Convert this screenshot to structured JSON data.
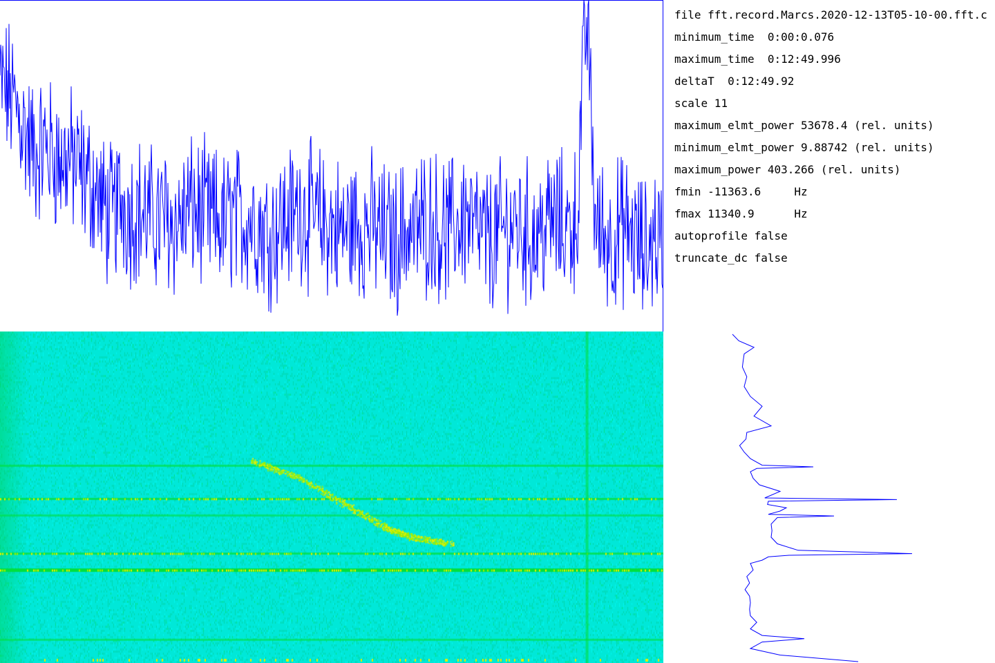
{
  "info": {
    "lines": [
      {
        "key": "file",
        "value": "fft.record.Marcs.2020-12-13T05-10-00.fft.c"
      },
      {
        "key": "minimum_time",
        "value": " 0:00:0.076"
      },
      {
        "key": "maximum_time",
        "value": " 0:12:49.996"
      },
      {
        "key": "deltaT",
        "value": " 0:12:49.92"
      },
      {
        "key": "scale",
        "value": "11"
      },
      {
        "key": "maximum_elmt_power",
        "value": "53678.4 (rel. units)"
      },
      {
        "key": "minimum_elmt_power",
        "value": "9.88742 (rel. units)"
      },
      {
        "key": "maximum_power",
        "value": "403.266 (rel. units)"
      },
      {
        "key": "fmin",
        "value": "-11363.6     Hz"
      },
      {
        "key": "fmax",
        "value": "11340.9      Hz"
      },
      {
        "key": "autoprofile",
        "value": "false"
      },
      {
        "key": "truncate_dc",
        "value": "false"
      }
    ]
  },
  "colors": {
    "trace": "#0000ff",
    "frame": "#0000ff",
    "waterfall_background": "#00e8d8",
    "waterfall_band": "#00e040",
    "waterfall_strong": "#a0f000",
    "waterfall_peak": "#e8f000"
  },
  "chart_data": [
    {
      "type": "line",
      "name": "time-power-trace",
      "xlim": [
        0.076,
        769.996
      ],
      "ylim": [
        0,
        403.266
      ],
      "grid": false,
      "series": [
        {
          "x": [
            0,
            10,
            20,
            30,
            40,
            50,
            60,
            70,
            80,
            90,
            100,
            110,
            120,
            130,
            140,
            150,
            160,
            170,
            180,
            190,
            200,
            210,
            220,
            230,
            240,
            250,
            260,
            270,
            280,
            290,
            300,
            310,
            320,
            330,
            340,
            350,
            360,
            370,
            380,
            390,
            400,
            410,
            420,
            430,
            440,
            450,
            460,
            470,
            480,
            490,
            500,
            510,
            520,
            530,
            540,
            550,
            560,
            570,
            580,
            590,
            600,
            610,
            620,
            630,
            640,
            650,
            660,
            670,
            673,
            676,
            679,
            682,
            685,
            688,
            691,
            694,
            700,
            710,
            720,
            730,
            740,
            750,
            760,
            770
          ],
          "y": [
            300,
            290,
            270,
            240,
            215,
            225,
            220,
            205,
            210,
            200,
            185,
            175,
            150,
            140,
            160,
            145,
            150,
            140,
            135,
            140,
            130,
            135,
            150,
            145,
            140,
            135,
            130,
            140,
            135,
            140,
            130,
            120,
            125,
            135,
            140,
            150,
            140,
            135,
            130,
            125,
            120,
            130,
            125,
            130,
            120,
            115,
            110,
            125,
            120,
            130,
            135,
            125,
            120,
            130,
            140,
            125,
            115,
            110,
            120,
            125,
            130,
            120,
            115,
            125,
            135,
            130,
            125,
            140,
            210,
            300,
            360,
            375,
            300,
            210,
            140,
            125,
            120,
            110,
            125,
            120,
            105,
            95,
            120,
            100
          ]
        }
      ]
    },
    {
      "type": "heatmap",
      "name": "waterfall-spectrogram",
      "xlim": [
        0.076,
        769.996
      ],
      "ylim": [
        -11363.6,
        11340.9
      ],
      "horizontal_bands": [
        {
          "freq_frac": 0.405,
          "strength": 0.55
        },
        {
          "freq_frac": 0.505,
          "strength": 0.8
        },
        {
          "freq_frac": 0.555,
          "strength": 0.4
        },
        {
          "freq_frac": 0.67,
          "strength": 0.75
        },
        {
          "freq_frac": 0.72,
          "strength": 1.0
        },
        {
          "freq_frac": 0.93,
          "strength": 0.45
        }
      ],
      "vertical_bands": [
        {
          "time_frac": 0.885,
          "strength": 0.6
        }
      ],
      "drifting_signal": [
        {
          "time_frac": 0.38,
          "freq_frac": 0.39
        },
        {
          "time_frac": 0.45,
          "freq_frac": 0.44
        },
        {
          "time_frac": 0.52,
          "freq_frac": 0.52
        },
        {
          "time_frac": 0.58,
          "freq_frac": 0.59
        },
        {
          "time_frac": 0.62,
          "freq_frac": 0.62
        },
        {
          "time_frac": 0.68,
          "freq_frac": 0.64
        }
      ]
    },
    {
      "type": "line",
      "name": "frequency-profile",
      "orientation": "vertical",
      "ylim": [
        -11363.6,
        11340.9
      ],
      "series": [
        {
          "freq_frac": [
            0.0,
            0.02,
            0.04,
            0.06,
            0.08,
            0.1,
            0.13,
            0.16,
            0.19,
            0.22,
            0.25,
            0.28,
            0.3,
            0.32,
            0.34,
            0.36,
            0.38,
            0.4,
            0.405,
            0.41,
            0.42,
            0.44,
            0.46,
            0.48,
            0.5,
            0.505,
            0.51,
            0.52,
            0.53,
            0.54,
            0.55,
            0.555,
            0.56,
            0.58,
            0.6,
            0.62,
            0.64,
            0.66,
            0.67,
            0.675,
            0.68,
            0.69,
            0.7,
            0.72,
            0.74,
            0.76,
            0.78,
            0.8,
            0.82,
            0.84,
            0.86,
            0.88,
            0.9,
            0.92,
            0.93,
            0.94,
            0.96,
            0.98,
            1.0
          ],
          "level": [
            0.0,
            0.02,
            0.12,
            0.05,
            0.06,
            0.04,
            0.08,
            0.05,
            0.1,
            0.15,
            0.12,
            0.2,
            0.08,
            0.06,
            0.04,
            0.05,
            0.1,
            0.15,
            0.45,
            0.12,
            0.1,
            0.1,
            0.15,
            0.25,
            0.18,
            0.9,
            0.2,
            0.18,
            0.3,
            0.25,
            0.2,
            0.55,
            0.25,
            0.2,
            0.22,
            0.2,
            0.25,
            0.35,
            1.0,
            0.3,
            0.2,
            0.15,
            0.1,
            0.1,
            0.08,
            0.08,
            0.07,
            0.08,
            0.1,
            0.08,
            0.1,
            0.12,
            0.1,
            0.15,
            0.4,
            0.15,
            0.1,
            0.25,
            0.7
          ]
        }
      ]
    }
  ]
}
